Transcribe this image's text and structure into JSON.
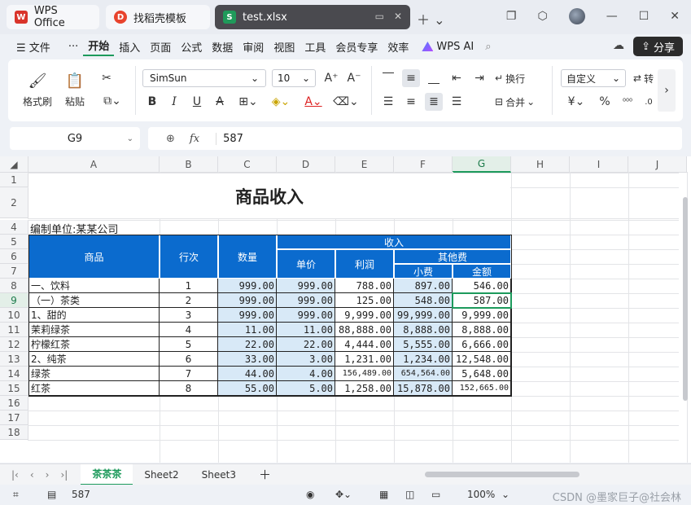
{
  "window": {
    "tabs": [
      {
        "label": "WPS Office"
      },
      {
        "label": "找稻壳模板"
      },
      {
        "label": "test.xlsx"
      }
    ]
  },
  "menu": {
    "items": [
      "文件",
      "···",
      "开始",
      "插入",
      "页面",
      "公式",
      "数据",
      "审阅",
      "视图",
      "工具",
      "会员专享",
      "效率"
    ],
    "ai": "WPS AI",
    "share": "分享"
  },
  "ribbon": {
    "format_painter": "格式刷",
    "paste": "粘贴",
    "font": "SimSun",
    "size": "10",
    "wrap": "换行",
    "merge": "合并",
    "number_format": "自定义",
    "convert_partial": "转"
  },
  "formula_bar": {
    "name_box": "G9",
    "fx": "fx",
    "value": "587"
  },
  "grid": {
    "columns": [
      "A",
      "B",
      "C",
      "D",
      "E",
      "F",
      "G",
      "H",
      "I",
      "J"
    ],
    "rows": [
      "1",
      "2",
      "3",
      "4",
      "5",
      "6",
      "7",
      "8",
      "9",
      "10",
      "11",
      "12",
      "13",
      "14",
      "15",
      "16",
      "17",
      "18"
    ]
  },
  "sheet": {
    "title": "商品收入",
    "unit": "编制单位:某某公司",
    "headers": {
      "product": "商品",
      "line": "行次",
      "qty": "数量",
      "income": "收入",
      "price": "单价",
      "profit": "利润",
      "other": "其他费",
      "tip": "小费",
      "amount": "金额"
    },
    "rows": [
      {
        "name": "一、饮料",
        "line": "1",
        "qty": "999.00",
        "price": "999.00",
        "profit": "788.00",
        "tip": "897.00",
        "amount": "546.00"
      },
      {
        "name": "（一）茶类",
        "line": "2",
        "qty": "999.00",
        "price": "999.00",
        "profit": "125.00",
        "tip": "548.00",
        "amount": "587.00"
      },
      {
        "name": "1、甜的",
        "line": "3",
        "qty": "999.00",
        "price": "999.00",
        "profit": "9,999.00",
        "tip": "99,999.00",
        "amount": "9,999.00"
      },
      {
        "name": "茉莉绿茶",
        "line": "4",
        "qty": "11.00",
        "price": "11.00",
        "profit": "88,888.00",
        "tip": "8,888.00",
        "amount": "8,888.00"
      },
      {
        "name": "柠檬红茶",
        "line": "5",
        "qty": "22.00",
        "price": "22.00",
        "profit": "4,444.00",
        "tip": "5,555.00",
        "amount": "6,666.00"
      },
      {
        "name": "2、纯茶",
        "line": "6",
        "qty": "33.00",
        "price": "3.00",
        "profit": "1,231.00",
        "tip": "1,234.00",
        "amount": "12,548.00"
      },
      {
        "name": "绿茶",
        "line": "7",
        "qty": "44.00",
        "price": "4.00",
        "profit": "156,489.00",
        "tip": "654,564.00",
        "amount": "5,648.00"
      },
      {
        "name": "红茶",
        "line": "8",
        "qty": "55.00",
        "price": "5.00",
        "profit": "1,258.00",
        "tip": "15,878.00",
        "amount": "152,665.00"
      }
    ]
  },
  "sheets": [
    "茶茶茶",
    "Sheet2",
    "Sheet3"
  ],
  "status": {
    "value": "587",
    "zoom": "100%",
    "watermark": "CSDN @墨家巨子@社会林"
  }
}
